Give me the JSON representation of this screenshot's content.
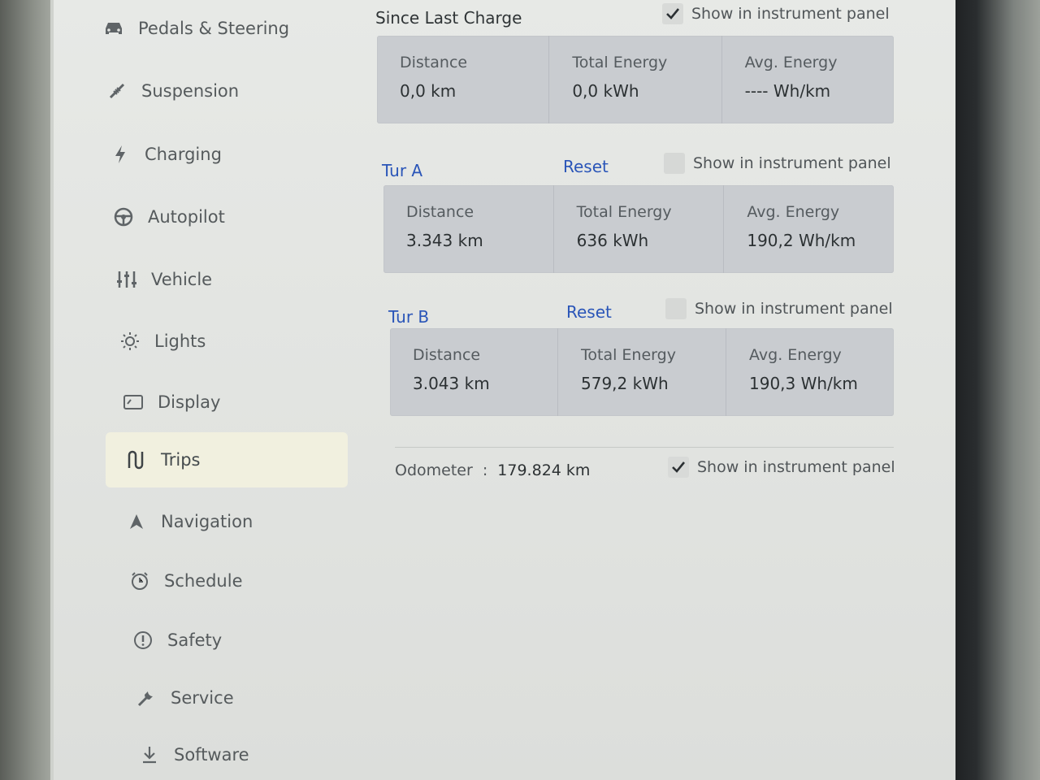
{
  "sidebar": {
    "items": [
      {
        "label": "Pedals & Steering",
        "icon": "car-icon"
      },
      {
        "label": "Suspension",
        "icon": "suspension-icon"
      },
      {
        "label": "Charging",
        "icon": "lightning-icon"
      },
      {
        "label": "Autopilot",
        "icon": "steering-wheel-icon"
      },
      {
        "label": "Vehicle",
        "icon": "sliders-icon"
      },
      {
        "label": "Lights",
        "icon": "sun-icon"
      },
      {
        "label": "Display",
        "icon": "display-icon"
      },
      {
        "label": "Trips",
        "icon": "trips-icon",
        "active": true
      },
      {
        "label": "Navigation",
        "icon": "navigation-arrow-icon"
      },
      {
        "label": "Schedule",
        "icon": "alarm-clock-icon"
      },
      {
        "label": "Safety",
        "icon": "safety-icon"
      },
      {
        "label": "Service",
        "icon": "wrench-icon"
      },
      {
        "label": "Software",
        "icon": "download-icon"
      }
    ]
  },
  "since_last_charge": {
    "title": "Since Last Charge",
    "show_label": "Show in instrument panel",
    "show_checked": true,
    "distance_label": "Distance",
    "distance_value": "0,0 km",
    "energy_label": "Total Energy",
    "energy_value": "0,0 kWh",
    "avg_label": "Avg. Energy",
    "avg_value": "---- Wh/km"
  },
  "trip_a": {
    "title": "Tur A",
    "reset_label": "Reset",
    "show_label": "Show in instrument panel",
    "show_checked": false,
    "distance_label": "Distance",
    "distance_value": "3.343 km",
    "energy_label": "Total Energy",
    "energy_value": "636 kWh",
    "avg_label": "Avg. Energy",
    "avg_value": "190,2 Wh/km"
  },
  "trip_b": {
    "title": "Tur B",
    "reset_label": "Reset",
    "show_label": "Show in instrument panel",
    "show_checked": false,
    "distance_label": "Distance",
    "distance_value": "3.043 km",
    "energy_label": "Total Energy",
    "energy_value": "579,2 kWh",
    "avg_label": "Avg. Energy",
    "avg_value": "190,3 Wh/km"
  },
  "odometer": {
    "label": "Odometer",
    "separator": ":",
    "value": "179.824 km",
    "show_label": "Show in instrument panel",
    "show_checked": true
  },
  "colors": {
    "link": "#2a55b8",
    "active_bg": "#f1f0df",
    "card_bg": "#c9ccd0"
  }
}
